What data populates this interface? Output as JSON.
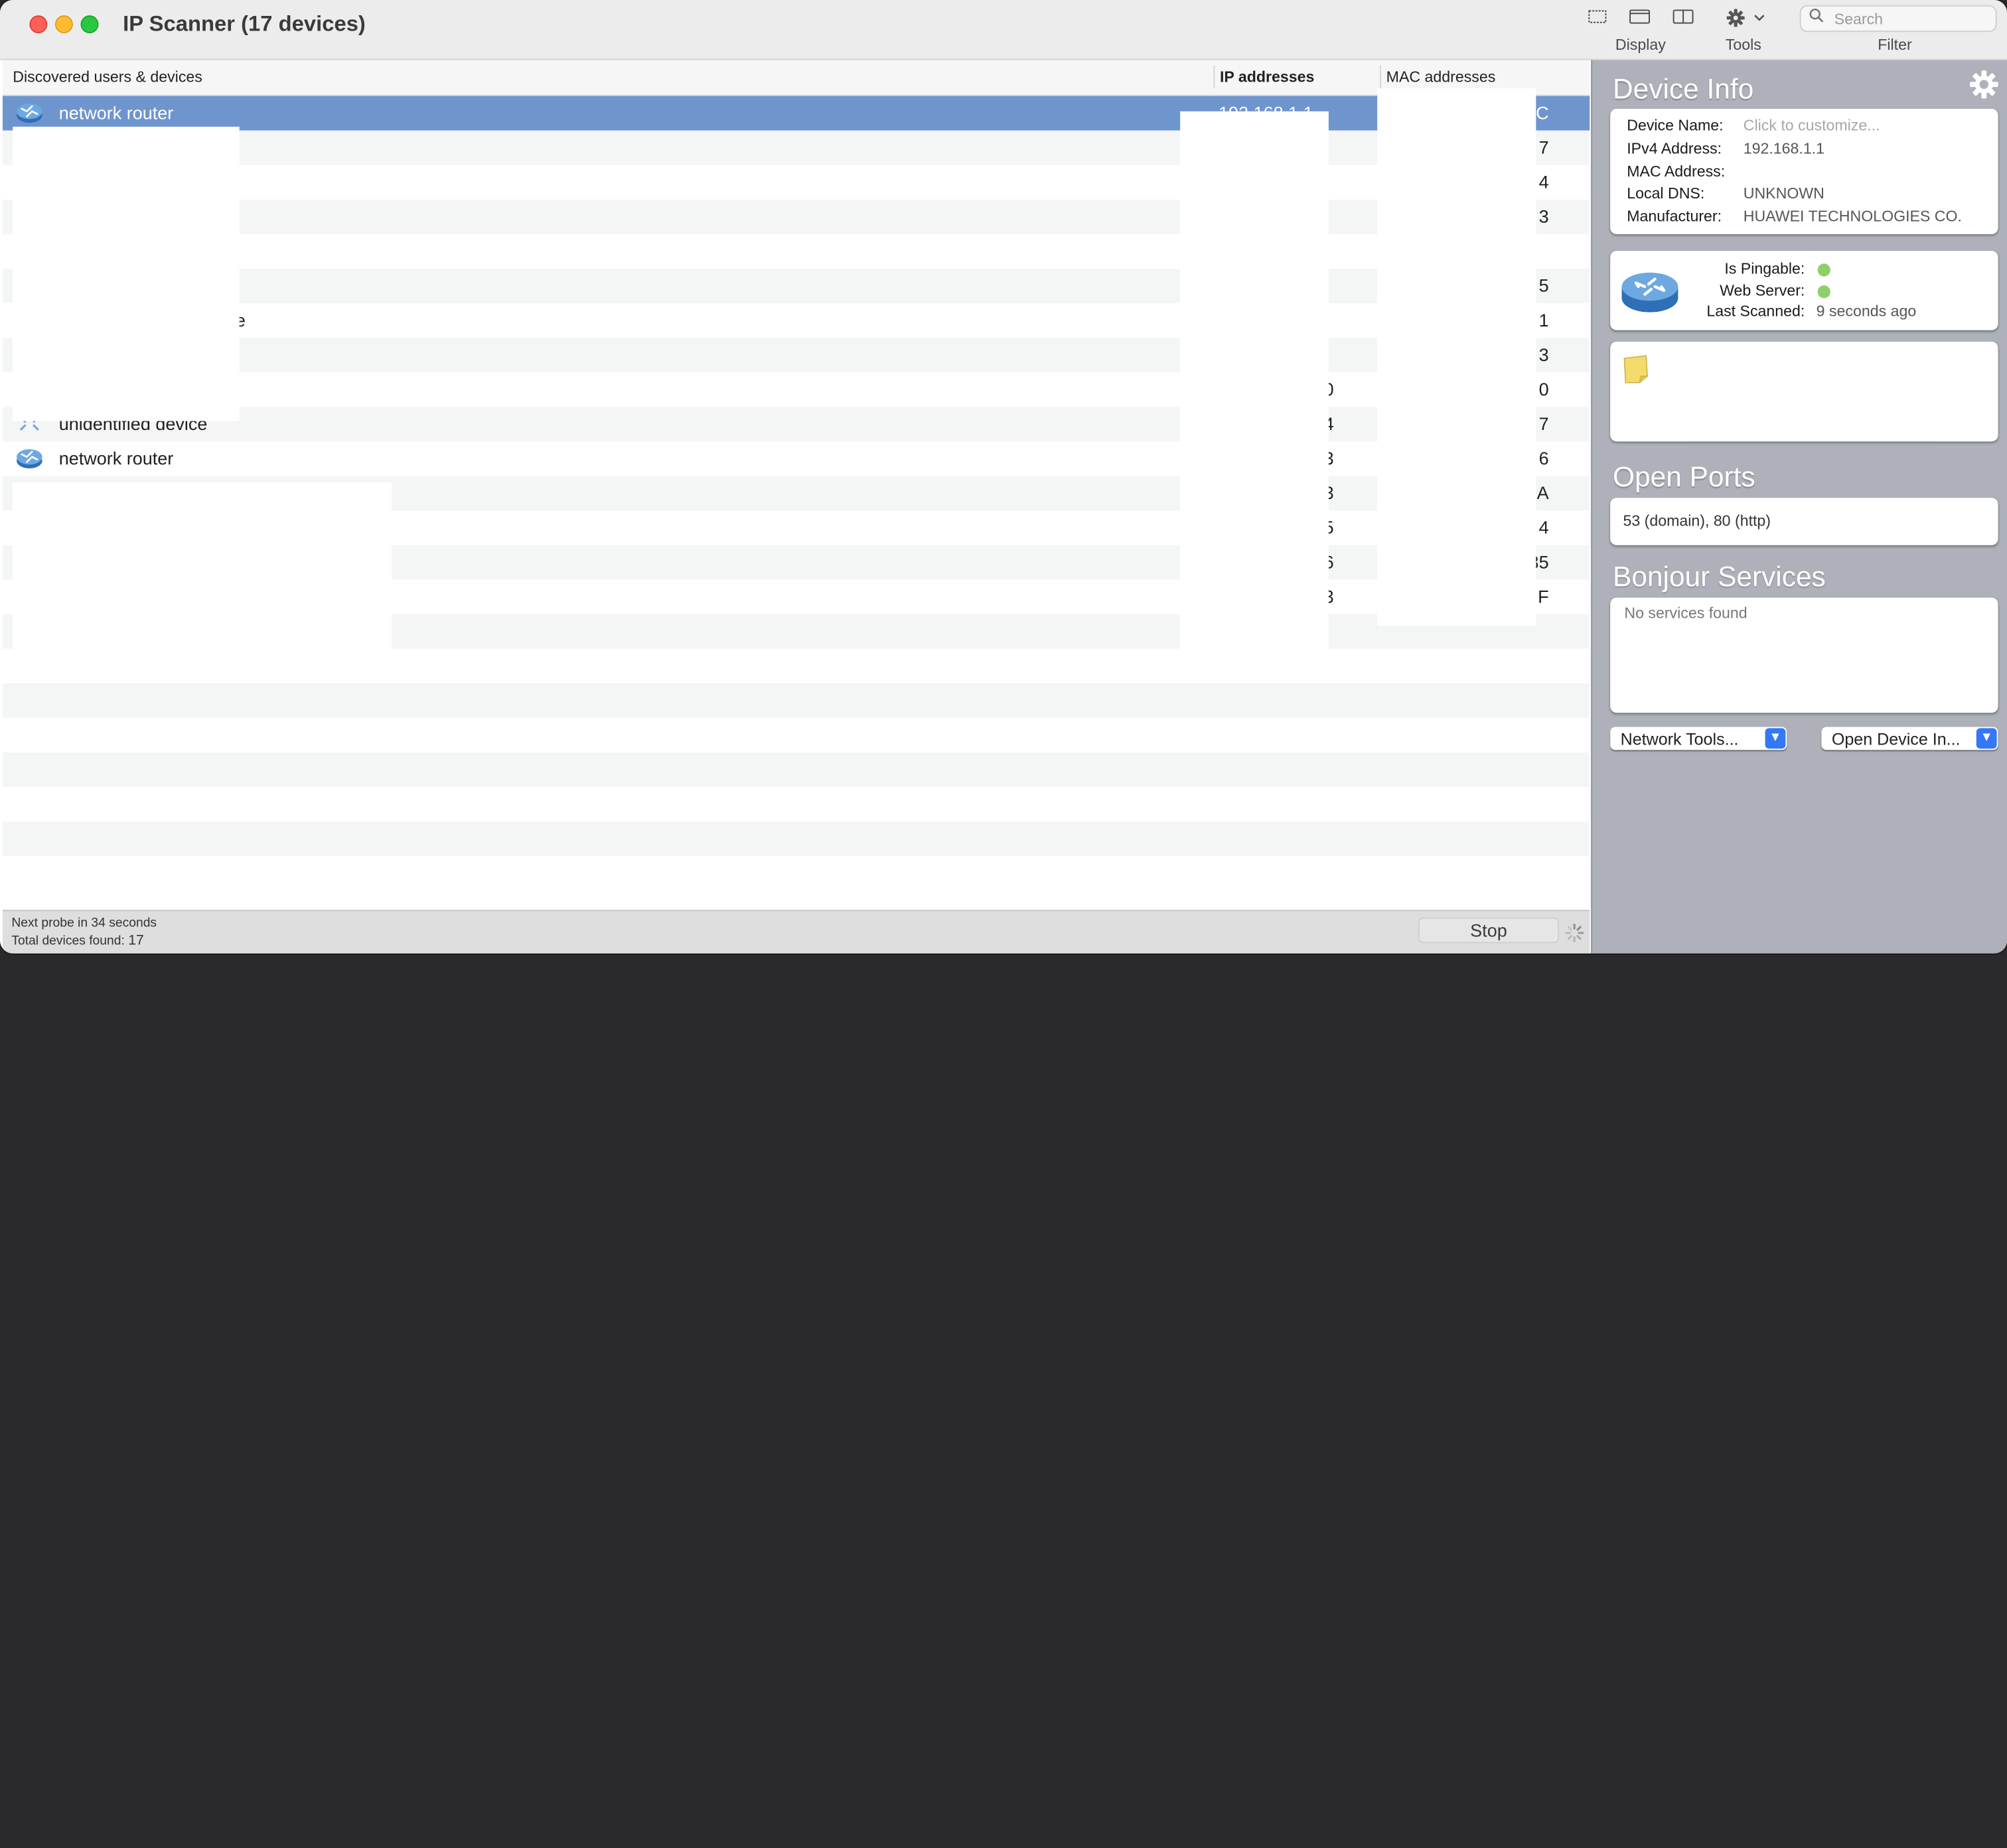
{
  "window": {
    "title": "IP Scanner (17 devices)"
  },
  "toolbar": {
    "display_label": "Display",
    "tools_label": "Tools",
    "filter_label": "Filter",
    "search_placeholder": "Search"
  },
  "table": {
    "headers": {
      "name": "Discovered users & devices",
      "ip": "IP addresses",
      "mac": "MAC addresses"
    },
    "rows": [
      {
        "name": "network router",
        "ip": "192.168.1.1",
        "mac": "C",
        "icon": "router-icon",
        "selected": true
      },
      {
        "name": "",
        "ip": "",
        "mac": "7",
        "icon": ""
      },
      {
        "name": "",
        "ip": "",
        "mac": "4",
        "icon": ""
      },
      {
        "name": "",
        "ip": "",
        "mac": "3",
        "icon": ""
      },
      {
        "name": "",
        "ip": "",
        "mac": "",
        "icon": ""
      },
      {
        "name": "",
        "ip": "",
        "mac": "5",
        "icon": ""
      },
      {
        "name": "e",
        "ip": "",
        "mac": "1",
        "icon": ""
      },
      {
        "name": "",
        "ip": "",
        "mac": "3",
        "icon": ""
      },
      {
        "name": "",
        "ip": "0",
        "mac": "0",
        "icon": ""
      },
      {
        "name": "unidentified device",
        "ip": "4",
        "mac": "7",
        "icon": "unknown-device-icon"
      },
      {
        "name": "network router",
        "ip": "3",
        "mac": "6",
        "icon": "router-icon"
      },
      {
        "name": "",
        "ip": "3",
        "mac": "A",
        "icon": ""
      },
      {
        "name": "",
        "ip": "5",
        "mac": "4",
        "icon": ""
      },
      {
        "name": "",
        "ip": "6",
        "mac": "35",
        "icon": ""
      },
      {
        "name": "",
        "ip": "3",
        "mac": "F",
        "icon": ""
      },
      {
        "name": "",
        "ip": "",
        "mac": "",
        "icon": ""
      }
    ]
  },
  "status": {
    "next_probe": "Next probe in 34 seconds",
    "total_label": "Total devices found:",
    "total_count": "17",
    "stop_label": "Stop"
  },
  "panel": {
    "device_info_title": "Device Info",
    "device_name_label": "Device Name:",
    "device_name_value": "Click to customize...",
    "ipv4_label": "IPv4 Address:",
    "ipv4_value": "192.168.1.1",
    "mac_label": "MAC Address:",
    "dns_label": "Local DNS:",
    "dns_value": "UNKNOWN",
    "manufacturer_label": "Manufacturer:",
    "manufacturer_value": "HUAWEI TECHNOLOGIES CO.",
    "pingable_label": "Is Pingable:",
    "webserver_label": "Web Server:",
    "last_scanned_label": "Last Scanned:",
    "last_scanned_value": "9 seconds ago",
    "status_color": "#8fcf6b",
    "open_ports_title": "Open Ports",
    "open_ports_value": "53 (domain), 80 (http)",
    "bonjour_title": "Bonjour Services",
    "bonjour_value": "No services found",
    "network_tools_label": "Network Tools...",
    "open_device_label": "Open Device In..."
  }
}
